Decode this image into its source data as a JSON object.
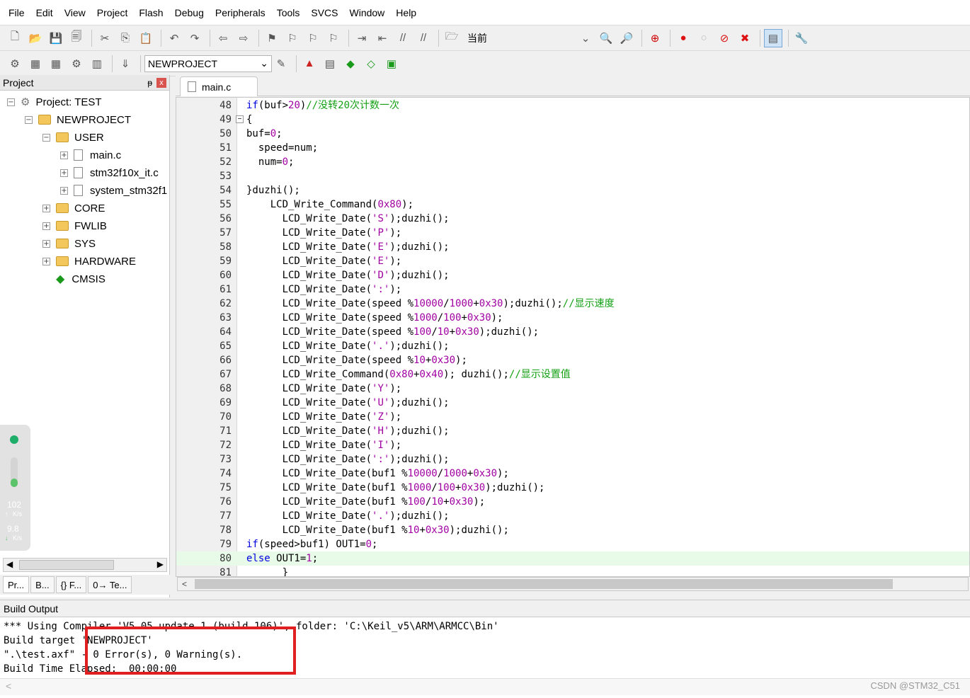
{
  "menu": [
    "File",
    "Edit",
    "View",
    "Project",
    "Flash",
    "Debug",
    "Peripherals",
    "Tools",
    "SVCS",
    "Window",
    "Help"
  ],
  "toolbar1": {
    "target_combo": "当前"
  },
  "toolbar2": {
    "target_name": "NEWPROJECT"
  },
  "project_panel": {
    "title": "Project",
    "pin": "ᵽ",
    "close": "x",
    "root": "Project: TEST",
    "target": "NEWPROJECT",
    "groups": [
      {
        "name": "USER",
        "files": [
          "main.c",
          "stm32f10x_it.c",
          "system_stm32f1"
        ]
      },
      {
        "name": "CORE"
      },
      {
        "name": "FWLIB"
      },
      {
        "name": "SYS"
      },
      {
        "name": "HARDWARE"
      },
      {
        "name": "CMSIS"
      }
    ],
    "tabs": [
      "Pr...",
      "B...",
      "{} F...",
      "0→ Te..."
    ]
  },
  "net_widget": {
    "up_value": "102",
    "up_unit": "K/s",
    "down_value": "9.8",
    "down_unit": "K/s",
    "up_arrow": "↑",
    "down_arrow": "↓"
  },
  "editor": {
    "tab": "main.c",
    "lines": [
      {
        "n": "48",
        "t": "if(buf>20)//没转20次计数一次"
      },
      {
        "n": "49",
        "t": "{"
      },
      {
        "n": "50",
        "t": "buf=0;"
      },
      {
        "n": "51",
        "t": "  speed=num;"
      },
      {
        "n": "52",
        "t": "  num=0;"
      },
      {
        "n": "53",
        "t": ""
      },
      {
        "n": "54",
        "t": "}duzhi();"
      },
      {
        "n": "55",
        "t": "    LCD_Write_Command(0x80);"
      },
      {
        "n": "56",
        "t": "      LCD_Write_Date('S');duzhi();"
      },
      {
        "n": "57",
        "t": "      LCD_Write_Date('P');"
      },
      {
        "n": "58",
        "t": "      LCD_Write_Date('E');duzhi();"
      },
      {
        "n": "59",
        "t": "      LCD_Write_Date('E');"
      },
      {
        "n": "60",
        "t": "      LCD_Write_Date('D');duzhi();"
      },
      {
        "n": "61",
        "t": "      LCD_Write_Date(':');"
      },
      {
        "n": "62",
        "t": "      LCD_Write_Date(speed %10000/1000+0x30);duzhi();//显示速度"
      },
      {
        "n": "63",
        "t": "      LCD_Write_Date(speed %1000/100+0x30);"
      },
      {
        "n": "64",
        "t": "      LCD_Write_Date(speed %100/10+0x30);duzhi();"
      },
      {
        "n": "65",
        "t": "      LCD_Write_Date('.');duzhi();"
      },
      {
        "n": "66",
        "t": "      LCD_Write_Date(speed %10+0x30);"
      },
      {
        "n": "67",
        "t": "      LCD_Write_Command(0x80+0x40); duzhi();//显示设置值"
      },
      {
        "n": "68",
        "t": "      LCD_Write_Date('Y');"
      },
      {
        "n": "69",
        "t": "      LCD_Write_Date('U');duzhi();"
      },
      {
        "n": "70",
        "t": "      LCD_Write_Date('Z');"
      },
      {
        "n": "71",
        "t": "      LCD_Write_Date('H');duzhi();"
      },
      {
        "n": "72",
        "t": "      LCD_Write_Date('I');"
      },
      {
        "n": "73",
        "t": "      LCD_Write_Date(':');duzhi();"
      },
      {
        "n": "74",
        "t": "      LCD_Write_Date(buf1 %10000/1000+0x30);"
      },
      {
        "n": "75",
        "t": "      LCD_Write_Date(buf1 %1000/100+0x30);duzhi();"
      },
      {
        "n": "76",
        "t": "      LCD_Write_Date(buf1 %100/10+0x30);"
      },
      {
        "n": "77",
        "t": "      LCD_Write_Date('.');duzhi();"
      },
      {
        "n": "78",
        "t": "      LCD_Write_Date(buf1 %10+0x30);duzhi();"
      },
      {
        "n": "79",
        "t": "if(speed>buf1) OUT1=0;"
      },
      {
        "n": "80",
        "t": "else OUT1=1;"
      },
      {
        "n": "81",
        "t": "      }"
      }
    ]
  },
  "build_output": {
    "title": "Build Output",
    "lines": [
      "*** Using Compiler 'V5.05 update 1 (build 106)', folder: 'C:\\Keil_v5\\ARM\\ARMCC\\Bin'",
      "Build target 'NEWPROJECT'",
      "\".\\test.axf\" - 0 Error(s), 0 Warning(s).",
      "Build Time Elapsed:  00:00:00"
    ]
  },
  "watermark": "CSDN @STM32_C51",
  "colors": {
    "keyword": "#0000e0",
    "number": "#a000a0",
    "comment": "#14a014",
    "highlight_line": "#e8fbe8",
    "error_box": "#e02020"
  }
}
